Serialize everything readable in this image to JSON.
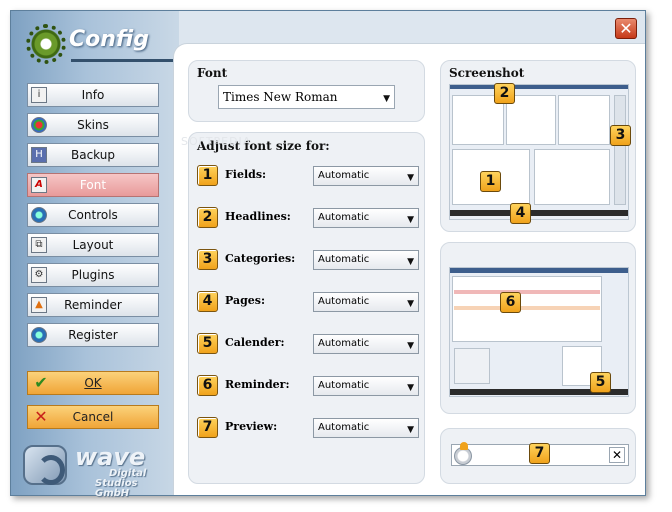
{
  "window": {
    "title": "Config",
    "close_symbol": "✕"
  },
  "sidebar": {
    "items": [
      {
        "label": "Info",
        "icon": "info-icon"
      },
      {
        "label": "Skins",
        "icon": "skins-icon"
      },
      {
        "label": "Backup",
        "icon": "backup-icon"
      },
      {
        "label": "Font",
        "icon": "font-icon",
        "active": true
      },
      {
        "label": "Controls",
        "icon": "controls-icon"
      },
      {
        "label": "Layout",
        "icon": "layout-icon"
      },
      {
        "label": "Plugins",
        "icon": "plugins-icon"
      },
      {
        "label": "Reminder",
        "icon": "reminder-icon"
      },
      {
        "label": "Register",
        "icon": "register-icon"
      }
    ],
    "ok_label": "OK",
    "cancel_label": "Cancel"
  },
  "logo": {
    "line1": "wave",
    "line2": "Digital",
    "line3": "Studios GmbH"
  },
  "font_panel": {
    "title": "Font",
    "selected_font": "Times New Roman"
  },
  "size_panel": {
    "title": "Adjust font size for:",
    "rows": [
      {
        "num": "1",
        "label": "Fields:",
        "value": "Automatic"
      },
      {
        "num": "2",
        "label": "Headlines:",
        "value": "Automatic"
      },
      {
        "num": "3",
        "label": "Categories:",
        "value": "Automatic"
      },
      {
        "num": "4",
        "label": "Pages:",
        "value": "Automatic"
      },
      {
        "num": "5",
        "label": "Calender:",
        "value": "Automatic"
      },
      {
        "num": "6",
        "label": "Reminder:",
        "value": "Automatic"
      },
      {
        "num": "7",
        "label": "Preview:",
        "value": "Automatic"
      }
    ]
  },
  "screenshot_panel": {
    "title": "Screenshot",
    "markers_top": [
      "2",
      "3",
      "1",
      "4"
    ],
    "markers_bottom": [
      "6",
      "5"
    ],
    "marker_preview": "7"
  },
  "colors": {
    "accent": "#f0a21b",
    "active_nav": "#e89a9a",
    "close": "#c63a19"
  }
}
